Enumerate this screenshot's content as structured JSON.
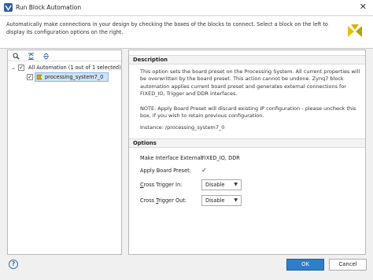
{
  "window": {
    "title": "Run Block Automation",
    "close_glyph": "✕",
    "icon": "vivado-icon"
  },
  "header": {
    "text": "Automatically make connections in your design by checking the boxes of the blocks to connect. Select a block on the left to display its configuration options on the right.",
    "logo": "xilinx-logo"
  },
  "toolbar": {
    "icons": [
      "search-icon",
      "collapse-all-icon",
      "expand-all-icon"
    ]
  },
  "tree": {
    "root": {
      "label": "All Automation (1 out of 1 selected)",
      "checked": true,
      "expanded": true
    },
    "child": {
      "label": "processing_system7_0",
      "checked": true,
      "selected": true
    }
  },
  "description": {
    "heading": "Description",
    "para1": "This option sets the board preset on the Processing System. All current properties will be overwritten by the board preset. This action cannot be undone. Zynq7 block automation applies current board preset and generates external connections for FIXED_IO, Trigger and DDR interfaces.",
    "para2": "NOTE: Apply Board Preset will discard existing IP configuration - please uncheck this box, if you wish to retain previous configuration.",
    "instance": "Instance: /processing_system7_0"
  },
  "options": {
    "heading": "Options",
    "make_interface_label": "Make Interface External:",
    "make_interface_value": "FIXED_IO, DDR",
    "apply_board_preset_label": "Apply Board Preset:",
    "apply_board_preset_checked": true,
    "cross_trigger_in_label_pre": "C",
    "cross_trigger_in_label_rest": "ross Trigger In:",
    "cross_trigger_in_value": "Disable",
    "cross_trigger_out_label_pre": "Cross ",
    "cross_trigger_out_label_u": "T",
    "cross_trigger_out_label_post": "rigger Out:",
    "cross_trigger_out_value": "Disable"
  },
  "footer": {
    "help": "?",
    "ok_label": "OK",
    "cancel_label": "Cancel"
  },
  "colors": {
    "accent": "#2f7ec8",
    "selection": "#cfe3f6"
  }
}
